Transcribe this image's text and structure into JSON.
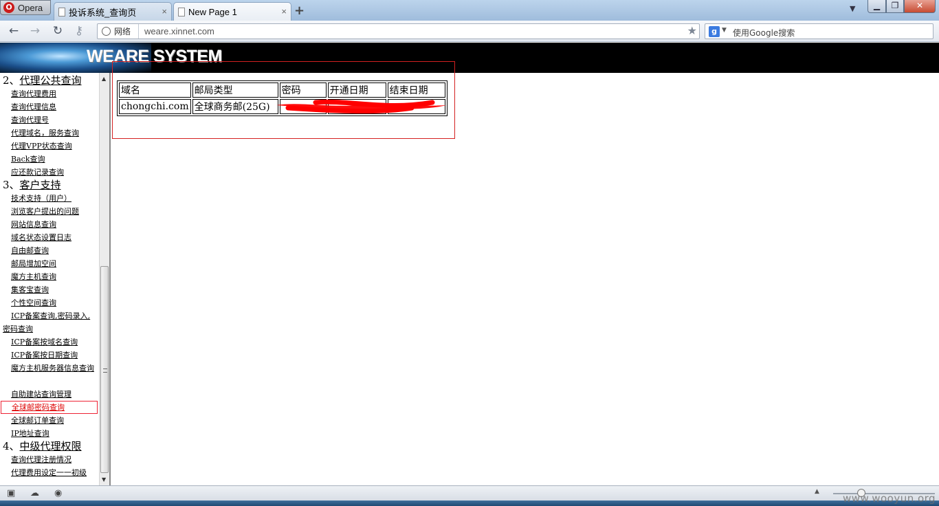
{
  "browser": {
    "menu_label": "Opera",
    "tabs": [
      {
        "title": "投诉系统_查询页",
        "close": "×"
      },
      {
        "title": "New Page 1",
        "close": "×"
      }
    ],
    "new_tab": "+",
    "tab_menu": "▼",
    "address": {
      "site_label": "网络",
      "url": "weare.xinnet.com"
    },
    "search_placeholder": "使用Google搜索",
    "search_engine_letter": "g"
  },
  "header": {
    "logo_text": "WEARE SYSTEM"
  },
  "sidebar": {
    "sections": [
      {
        "number": "2、",
        "title": "代理公共查询",
        "items": [
          "查询代理费用",
          "查询代理信息",
          "查询代理号",
          "代理域名，服务查询",
          "代理VPP状态查询",
          "Back查询",
          "应还款记录查询"
        ]
      },
      {
        "number": "3、",
        "title": "客户支持",
        "items": [
          "技术支持（用户）",
          "浏览客户提出的问题",
          "网站信息查询",
          "域名状态设置日志",
          "自由邮查询",
          "邮局增加空间",
          "魔方主机查询",
          "集客宝查询",
          "个性空间查询",
          "ICP备案查询,密码录入,密码查询",
          "ICP备案按域名查询",
          "ICP备案按日期查询",
          "魔方主机服务器信息查询",
          "自助建站查询管理",
          "全球邮密码查询",
          "全球邮订单查询",
          "IP地址查询"
        ]
      },
      {
        "number": "4、",
        "title": "中级代理权限",
        "items": [
          "查询代理注册情况",
          "代理费用设定一一初级"
        ]
      }
    ],
    "active_item": "全球邮密码查询"
  },
  "result_table": {
    "headers": [
      "域名",
      "邮局类型",
      "密码",
      "开通日期",
      "结束日期"
    ],
    "rows": [
      [
        "chongchi.com",
        "全球商务邮(25G)",
        "",
        "",
        ""
      ]
    ],
    "redaction_color": "#ff0000"
  },
  "watermark": "www.wooyun.org"
}
